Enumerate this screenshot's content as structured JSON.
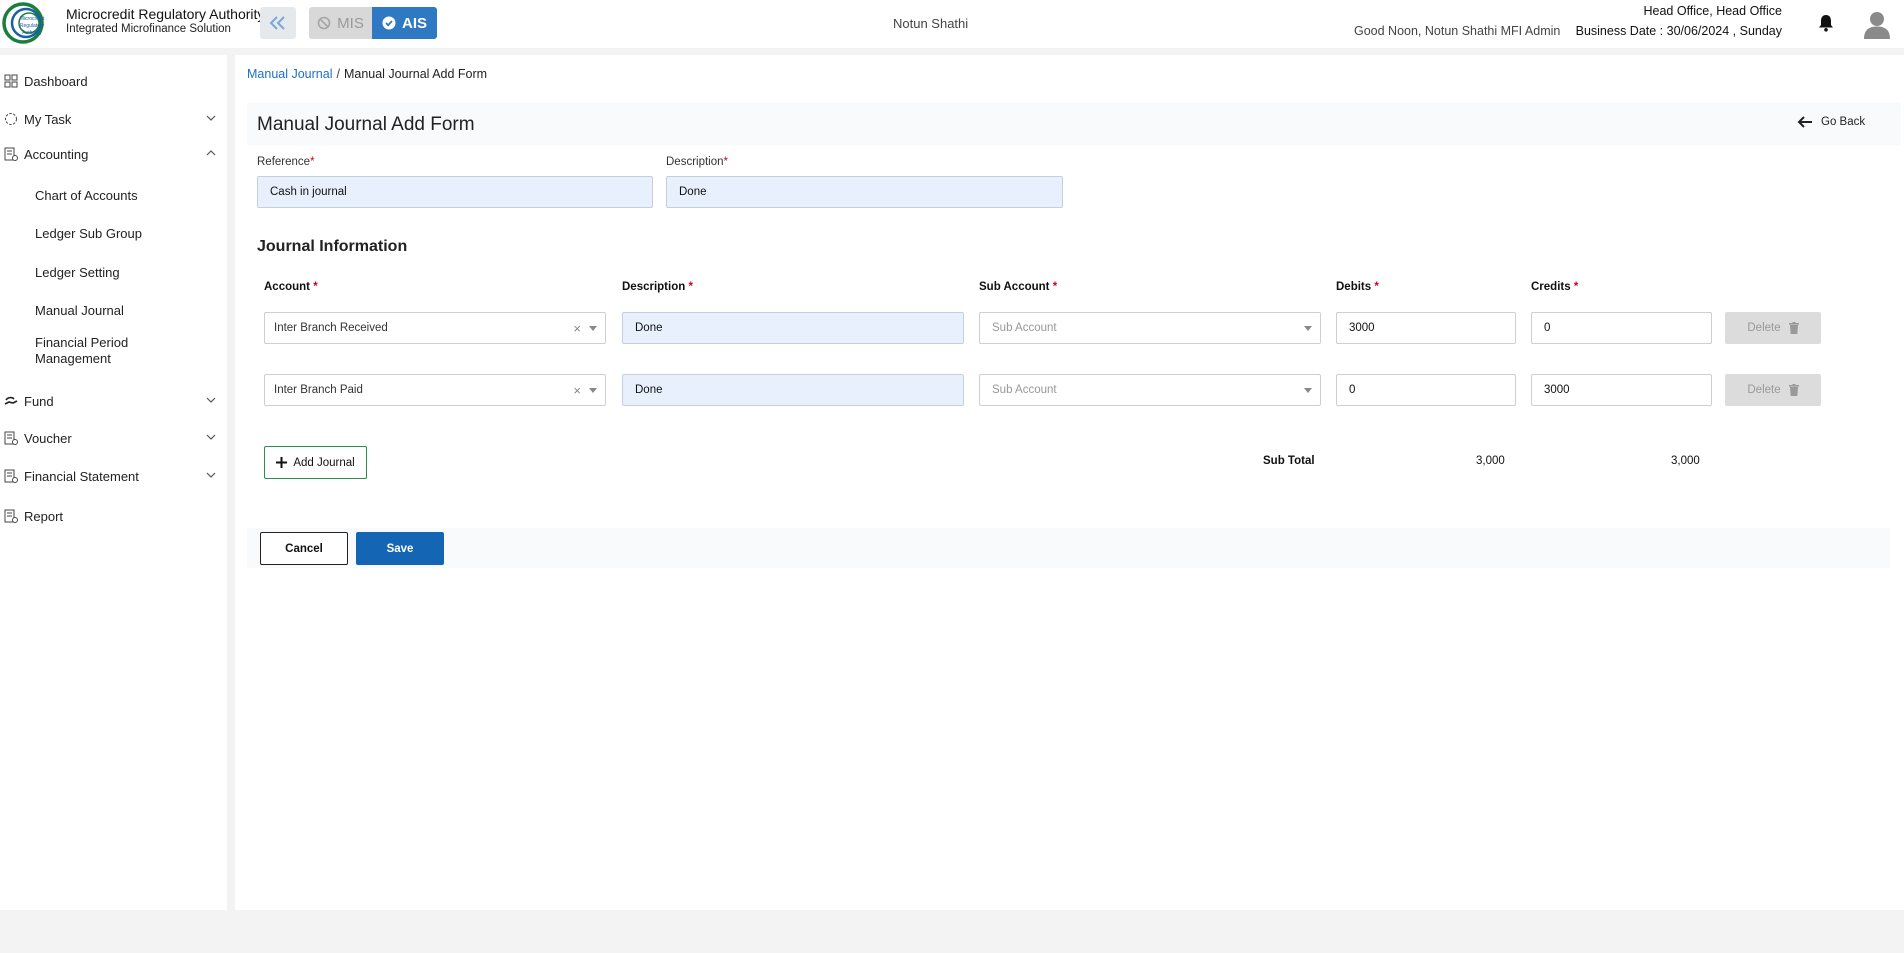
{
  "header": {
    "org_name": "Microcredit Regulatory Authority",
    "org_sub": "Integrated Microfinance Solution",
    "logo_text": "Microcredit Regulatory Authority",
    "switch": {
      "mis": "MIS",
      "ais": "AIS"
    },
    "center_name": "Notun Shathi",
    "greeting": "Good Noon, Notun Shathi MFI Admin",
    "office": "Head Office, Head Office",
    "business_date": "Business Date : 30/06/2024 , Sunday"
  },
  "sidebar": {
    "items": [
      {
        "label": "Dashboard",
        "icon": "grid-icon"
      },
      {
        "label": "My Task",
        "icon": "task-icon"
      },
      {
        "label": "Accounting",
        "icon": "ledger-icon"
      },
      {
        "label": "Fund",
        "icon": "hand-coin-icon"
      },
      {
        "label": "Voucher",
        "icon": "ledger-icon"
      },
      {
        "label": "Financial Statement",
        "icon": "ledger-icon"
      },
      {
        "label": "Report",
        "icon": "ledger-icon"
      }
    ],
    "accounting_sub": [
      "Chart of Accounts",
      "Ledger Sub Group",
      "Ledger Setting",
      "Manual Journal",
      "Financial Period Management"
    ]
  },
  "breadcrumb": {
    "parent": "Manual Journal",
    "separator": "/",
    "current": "Manual Journal Add Form"
  },
  "form": {
    "title": "Manual Journal Add Form",
    "go_back": "Go Back",
    "reference_label": "Reference",
    "reference_value": "Cash in journal",
    "description_label": "Description",
    "description_value": "Done",
    "required_mark": "*"
  },
  "journal": {
    "section_title": "Journal Information",
    "columns": {
      "account": "Account",
      "description": "Description",
      "sub_account": "Sub Account",
      "debits": "Debits",
      "credits": "Credits"
    },
    "rows": [
      {
        "account": "Inter Branch Received",
        "description": "Done",
        "sub_account_placeholder": "Sub Account",
        "debit": "3000",
        "credit": "0",
        "delete_label": "Delete"
      },
      {
        "account": "Inter Branch Paid",
        "description": "Done",
        "sub_account_placeholder": "Sub Account",
        "debit": "0",
        "credit": "3000",
        "delete_label": "Delete"
      }
    ],
    "add_label": "Add Journal",
    "subtotal_label": "Sub Total",
    "subtotal_debit": "3,000",
    "subtotal_credit": "3,000",
    "clear_glyph": "×"
  },
  "actions": {
    "cancel": "Cancel",
    "save": "Save"
  },
  "colors": {
    "primary": "#1565b5",
    "link": "#1d6fc7",
    "accent_green": "#2e8b57",
    "required": "#d0021b"
  }
}
